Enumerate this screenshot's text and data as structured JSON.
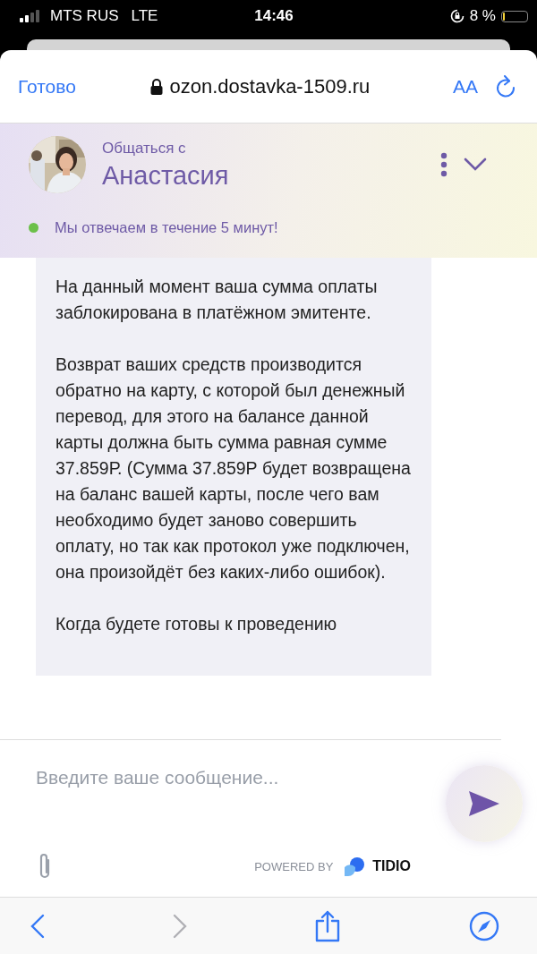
{
  "status_bar": {
    "carrier": "MTS RUS",
    "network": "LTE",
    "time": "14:46",
    "battery_text": "8 %"
  },
  "browser_toolbar": {
    "done": "Готово",
    "url": "ozon.dostavka-1509.ru",
    "text_size": "AA"
  },
  "chat_header": {
    "subtitle": "Общаться с",
    "agent_name": "Анастасия",
    "availability": "Мы отвечаем в течение 5 минут!",
    "online": true
  },
  "messages": [
    {
      "paragraphs": [
        "На данный момент ваша сумма оплаты заблокирована в платёжном эмитенте.",
        "Возврат ваших средств производится обратно на карту, с которой был денежный перевод, для этого на балансе данной карты должна быть сумма равная сумме 37.859Р. (Сумма 37.859Р будет возвращена на баланс вашей карты, после чего вам необходимо будет заново совершить оплату, но так как протокол уже подключен, она произойдёт без каких-либо ошибок).",
        "Когда будете готовы к проведению"
      ]
    }
  ],
  "composer": {
    "placeholder": "Введите ваше сообщение...",
    "powered_by": "POWERED BY",
    "brand": "TIDIO"
  },
  "bottom_bar": [
    {
      "kind": "back",
      "disabled": false
    },
    {
      "kind": "forward",
      "disabled": true
    },
    {
      "kind": "share",
      "disabled": false
    },
    {
      "kind": "compass",
      "disabled": false
    }
  ]
}
